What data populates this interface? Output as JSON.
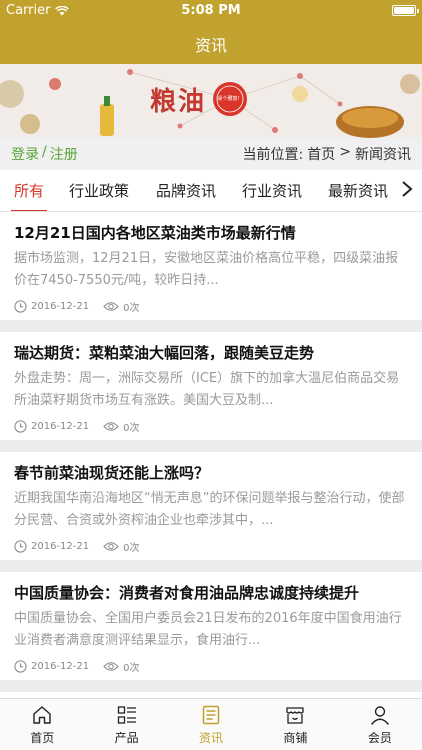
{
  "status_bar": {
    "carrier": "Carrier",
    "time": "5:08 PM"
  },
  "header": {
    "title": "资讯"
  },
  "banner": {
    "text": "粮油",
    "badge": "桌个腰鼓！"
  },
  "auth": {
    "login": "登录",
    "separator": "/",
    "register": "注册"
  },
  "breadcrumb": {
    "label": "当前位置:",
    "home": "首页",
    "separator": ">",
    "current": "新闻资讯"
  },
  "tabs": [
    {
      "label": "所有",
      "active": true
    },
    {
      "label": "行业政策",
      "active": false
    },
    {
      "label": "品牌资讯",
      "active": false
    },
    {
      "label": "行业资讯",
      "active": false
    },
    {
      "label": "最新资讯",
      "active": false
    }
  ],
  "articles": [
    {
      "title": "12月21日国内各地区菜油类市场最新行情",
      "desc": "据市场监测，12月21日，安徽地区菜油价格高位平稳，四级菜油报价在7450-7550元/吨，较昨日持...",
      "date": "2016-12-21",
      "views": "0次"
    },
    {
      "title": "瑞达期货：菜粕菜油大幅回落，跟随美豆走势",
      "desc": "外盘走势：周一，洲际交易所（ICE）旗下的加拿大温尼伯商品交易所油菜籽期货市场互有涨跌。美国大豆及制...",
      "date": "2016-12-21",
      "views": "0次"
    },
    {
      "title": "春节前菜油现货还能上涨吗？",
      "desc": "近期我国华南沿海地区“悄无声息”的环保问题举报与整治行动，使部分民营、合资或外资榨油企业也牵涉其中，...",
      "date": "2016-12-21",
      "views": "0次"
    },
    {
      "title": "中国质量协会：消费者对食用油品牌忠诚度持续提升",
      "desc": "中国质量协会、全国用户委员会21日发布的2016年度中国食用油行业消费者满意度测评结果显示，食用油行...",
      "date": "2016-12-21",
      "views": "0次"
    }
  ],
  "bottom_nav": [
    {
      "label": "首页",
      "icon": "home-icon",
      "active": false
    },
    {
      "label": "产品",
      "icon": "list-icon",
      "active": false
    },
    {
      "label": "资讯",
      "icon": "news-icon",
      "active": true
    },
    {
      "label": "商铺",
      "icon": "shop-icon",
      "active": false
    },
    {
      "label": "会员",
      "icon": "user-icon",
      "active": false
    }
  ],
  "colors": {
    "brand": "#c2a22e",
    "accent_red": "#d9352a",
    "auth_green": "#5ba537"
  }
}
